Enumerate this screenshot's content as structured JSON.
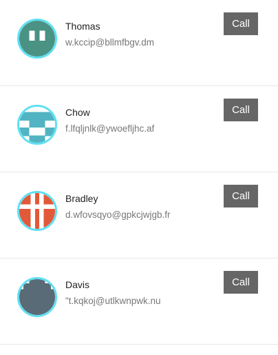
{
  "contacts": [
    {
      "name": "Thomas",
      "email": "w.kccip@bllmfbgv.dm",
      "call_label": "Call",
      "avatar_color": "#4a9284",
      "avatar_icon": "identicon-avatar"
    },
    {
      "name": "Chow",
      "email": "f.lfqljnlk@ywoefljhc.af",
      "call_label": "Call",
      "avatar_color": "#52b4c2",
      "avatar_icon": "identicon-avatar"
    },
    {
      "name": "Bradley",
      "email": "d.wfovsqyo@gpkcjwjgb.fr",
      "call_label": "Call",
      "avatar_color": "#e2593a",
      "avatar_icon": "identicon-avatar"
    },
    {
      "name": "Davis",
      "email": "\"t.kqkoj@utlkwnpwk.nu",
      "call_label": "Call",
      "avatar_color": "#5a6b78",
      "avatar_icon": "identicon-avatar"
    }
  ]
}
